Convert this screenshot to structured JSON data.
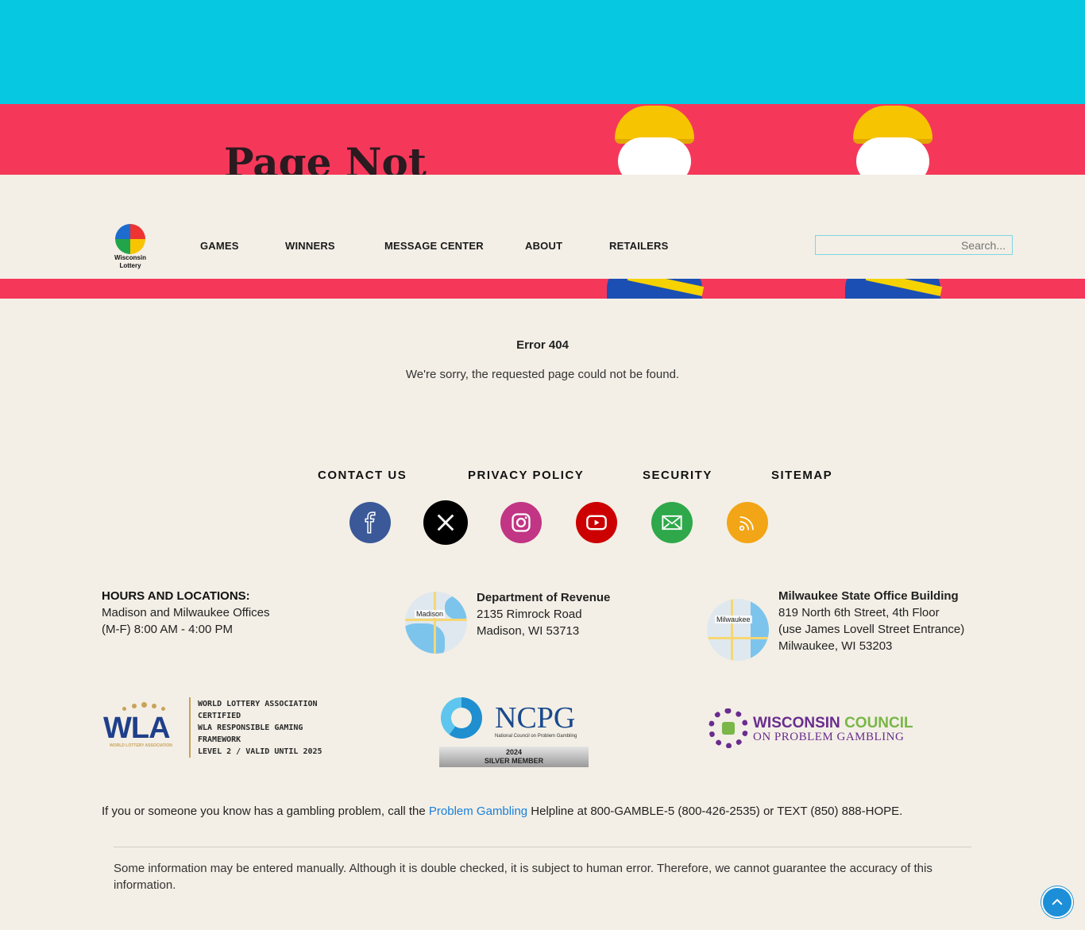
{
  "hero": {
    "title": "Page Not"
  },
  "logo": {
    "line1": "Wisconsin",
    "line2": "Lottery"
  },
  "nav": {
    "items": [
      "GAMES",
      "WINNERS",
      "MESSAGE CENTER",
      "ABOUT",
      "RETAILERS"
    ]
  },
  "search": {
    "placeholder": "Search..."
  },
  "error": {
    "title": "Error 404",
    "message": "We're sorry, the requested page could not be found."
  },
  "footer_links": [
    "CONTACT US",
    "PRIVACY POLICY",
    "SECURITY",
    "SITEMAP"
  ],
  "social": [
    {
      "icon": "facebook-icon",
      "color": "#3b5998"
    },
    {
      "icon": "x-icon",
      "color": "#000000"
    },
    {
      "icon": "instagram-icon",
      "color": "#c13584"
    },
    {
      "icon": "youtube-icon",
      "color": "#cc0000"
    },
    {
      "icon": "email-icon",
      "color": "#2ea84a"
    },
    {
      "icon": "rss-icon",
      "color": "#f2a516"
    }
  ],
  "locations": {
    "hours_title": "HOURS AND LOCATIONS:",
    "hours_line1": "Madison and Milwaukee Offices",
    "hours_line2": "(M-F) 8:00 AM - 4:00 PM",
    "madison": {
      "map_label": "Madison",
      "name": "Department of Revenue",
      "line1": "2135 Rimrock Road",
      "line2": "Madison, WI 53713"
    },
    "milwaukee": {
      "map_label": "Milwaukee",
      "name": "Milwaukee State Office Building",
      "line1": "819 North 6th Street, 4th Floor",
      "line2": "(use James Lovell Street Entrance)",
      "line3": "Milwaukee, WI 53203"
    }
  },
  "badges": {
    "wla": {
      "abbr": "WLA",
      "small": "WORLD LOTTERY ASSOCIATION",
      "lines": [
        "WORLD LOTTERY ASSOCIATION",
        "CERTIFIED",
        "WLA RESPONSIBLE GAMING",
        "FRAMEWORK",
        "LEVEL 2 / VALID UNTIL 2025"
      ]
    },
    "ncpg": {
      "abbr": "NCPG",
      "sub": "National Council on Problem Gambling",
      "year": "2024",
      "tier": "SILVER MEMBER"
    },
    "wcpg": {
      "line1a": "WISCONSIN",
      "line1b": "COUNCIL",
      "line2": "ON PROBLEM GAMBLING"
    }
  },
  "gambling": {
    "before": "If you or someone you know has a gambling problem, call the ",
    "link": "Problem Gambling",
    "after": " Helpline at 800-GAMBLE-5 (800-426-2535) or TEXT (850) 888-HOPE."
  },
  "disclaimer": "Some information may be entered manually. Although it is double checked, it is subject to human error. Therefore, we cannot guarantee the accuracy of this information."
}
